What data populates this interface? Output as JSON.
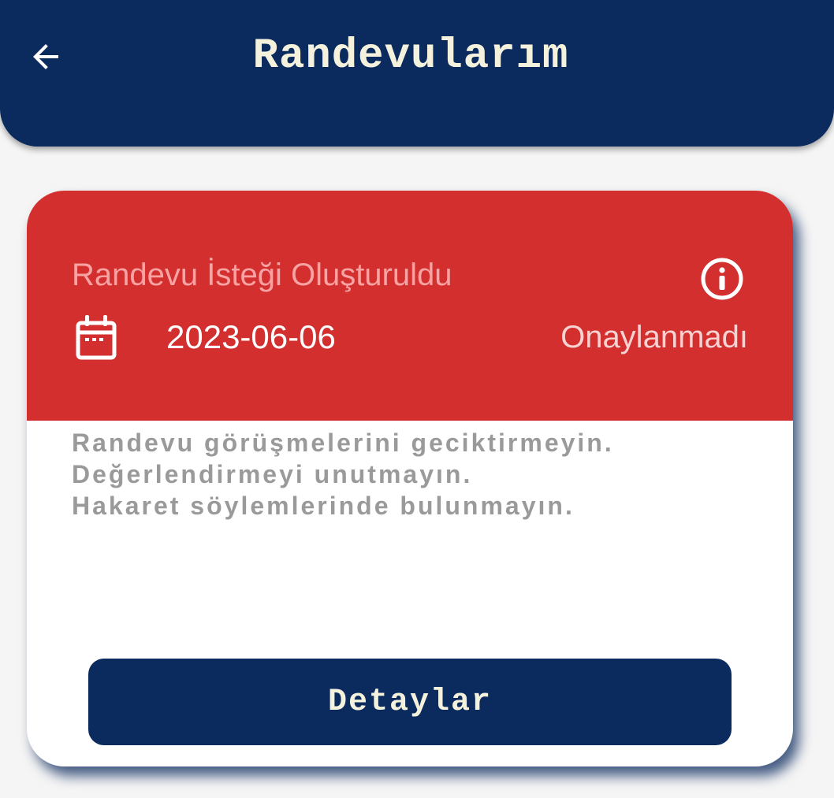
{
  "app_bar": {
    "title": "Randevularım",
    "back_icon": "arrow-left-icon",
    "background_color": "#0b2a5e"
  },
  "appointment_card": {
    "status_title": "Randevu İsteği Oluşturuldu",
    "date": "2023-06-06",
    "approval_status": "Onaylanmadı",
    "header_color": "#d32f2f",
    "icons": {
      "info": "info-icon",
      "calendar": "calendar-icon"
    },
    "notes": [
      "Randevu görüşmelerini geciktirmeyin.",
      "Değerlendirmeyi unutmayın.",
      "Hakaret söylemlerinde bulunmayın."
    ],
    "details_button_label": "Detaylar"
  }
}
